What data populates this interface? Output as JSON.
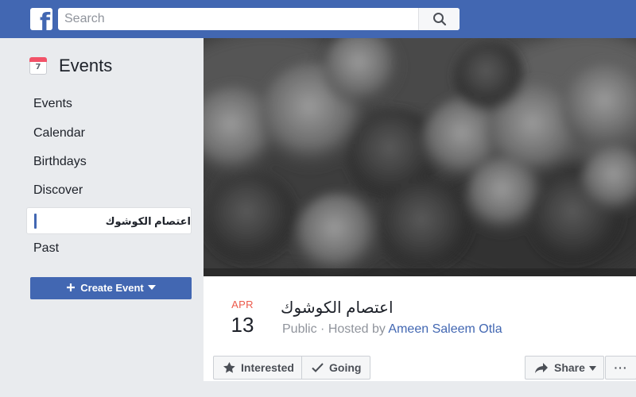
{
  "topbar": {
    "logo_letter": "f",
    "search_placeholder": "Search"
  },
  "sidebar": {
    "title": "Events",
    "calendar_day": "7",
    "items": [
      {
        "label": "Events"
      },
      {
        "label": "Calendar"
      },
      {
        "label": "Birthdays"
      },
      {
        "label": "Discover"
      },
      {
        "label": "اعتصام الكوشوك"
      },
      {
        "label": "Past"
      }
    ],
    "create_label": "Create Event"
  },
  "event": {
    "month": "APR",
    "day": "13",
    "title": "اعتصام الكوشوك",
    "privacy": "Public",
    "separator": "·",
    "hosted_prefix": "Hosted by",
    "host": "Ameen Saleem Otla"
  },
  "actions": {
    "interested": "Interested",
    "going": "Going",
    "share": "Share",
    "more": "···"
  },
  "colors": {
    "brand": "#4267b2",
    "date_month": "#ec5a4b",
    "page_bg": "#e9ebee"
  }
}
